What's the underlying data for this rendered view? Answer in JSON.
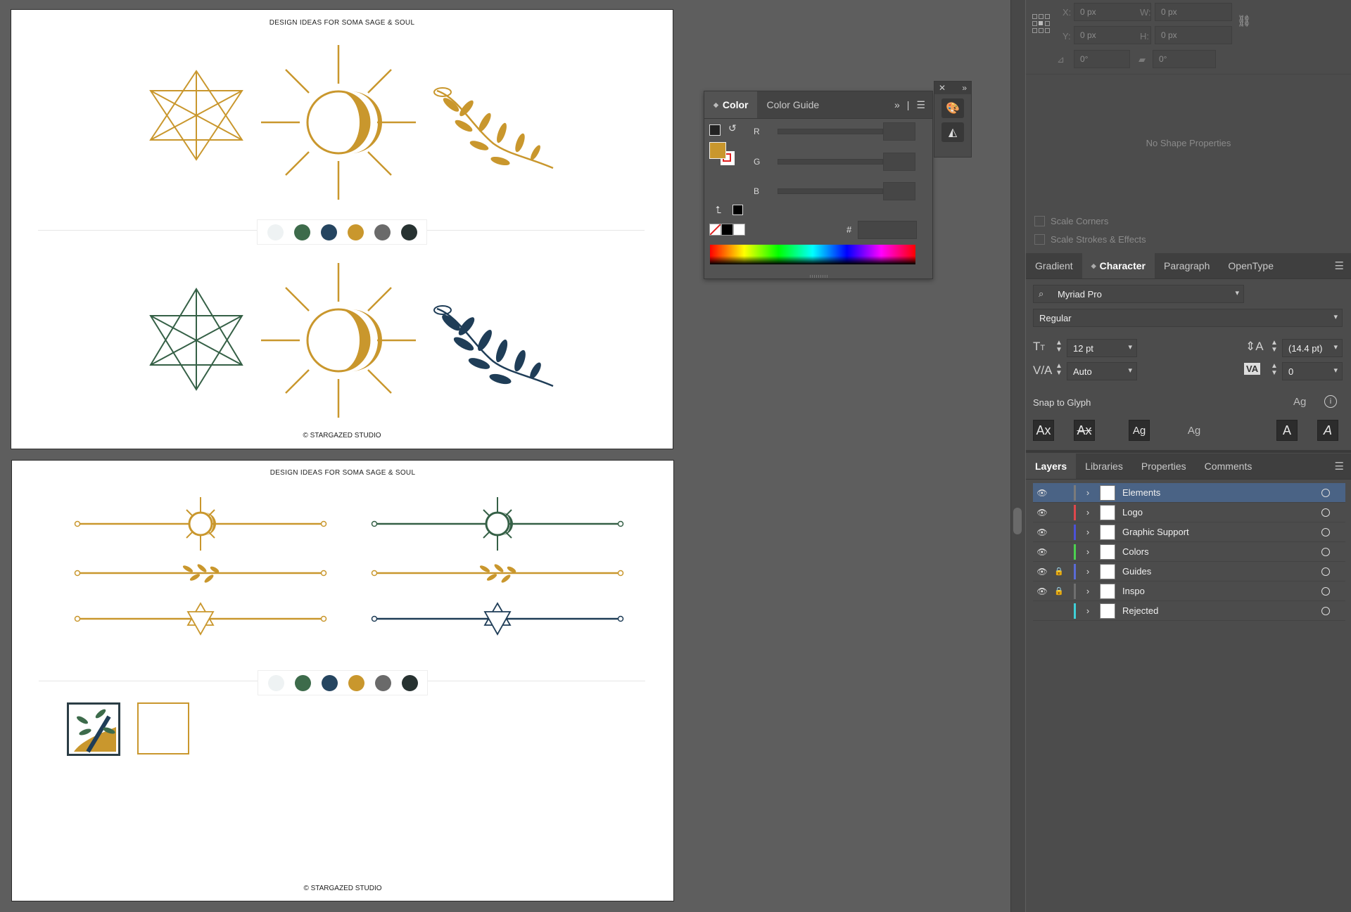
{
  "artboards": [
    {
      "title": "DESIGN IDEAS FOR SOMA SAGE & SOUL",
      "footer": "© STARGAZED STUDIO"
    },
    {
      "title": "DESIGN IDEAS FOR SOMA SAGE & SOUL",
      "footer": "© STARGAZED STUDIO"
    }
  ],
  "palette": [
    "#eef2f3",
    "#3d6b4b",
    "#254560",
    "#c9972d",
    "#6a6a6a",
    "#273231"
  ],
  "icon_colors": {
    "gold": "#c9972d",
    "green": "#356046",
    "navy": "#1f3d57"
  },
  "color_panel": {
    "tabs": [
      "Color",
      "Color Guide"
    ],
    "channels": [
      "R",
      "G",
      "B"
    ],
    "hex_label": "#",
    "fill_color": "#c9972d"
  },
  "transform": {
    "x_label": "X:",
    "x_value": "0 px",
    "y_label": "Y:",
    "y_value": "0 px",
    "w_label": "W:",
    "w_value": "0 px",
    "h_label": "H:",
    "h_value": "0 px",
    "angle_value": "0°",
    "shear_value": "0°"
  },
  "no_shape_text": "No Shape Properties",
  "checkboxes": [
    "Scale Corners",
    "Scale Strokes & Effects"
  ],
  "character_tabs": [
    "Gradient",
    "Character",
    "Paragraph",
    "OpenType"
  ],
  "character": {
    "font_family": "Myriad Pro",
    "font_style": "Regular",
    "font_size": "12 pt",
    "leading": "(14.4 pt)",
    "kerning": "Auto",
    "tracking": "0",
    "snap_label": "Snap to Glyph"
  },
  "layer_tabs": [
    "Layers",
    "Libraries",
    "Properties",
    "Comments"
  ],
  "layers": [
    {
      "name": "Elements",
      "color": "#7b7b7b",
      "visible": "👁",
      "locked": "",
      "selected": true
    },
    {
      "name": "Logo",
      "color": "#e0474c",
      "visible": "👁",
      "locked": "",
      "selected": false
    },
    {
      "name": "Graphic Support",
      "color": "#4b52d8",
      "visible": "👁",
      "locked": "",
      "selected": false
    },
    {
      "name": "Colors",
      "color": "#4cd150",
      "visible": "👁",
      "locked": "",
      "selected": false
    },
    {
      "name": "Guides",
      "color": "#5a6bd6",
      "visible": "👁",
      "locked": "🔒",
      "selected": false
    },
    {
      "name": "Inspo",
      "color": "#6f6f6f",
      "visible": "👁",
      "locked": "🔒",
      "selected": false
    },
    {
      "name": "Rejected",
      "color": "#3fd0d8",
      "visible": "",
      "locked": "",
      "selected": false
    }
  ]
}
